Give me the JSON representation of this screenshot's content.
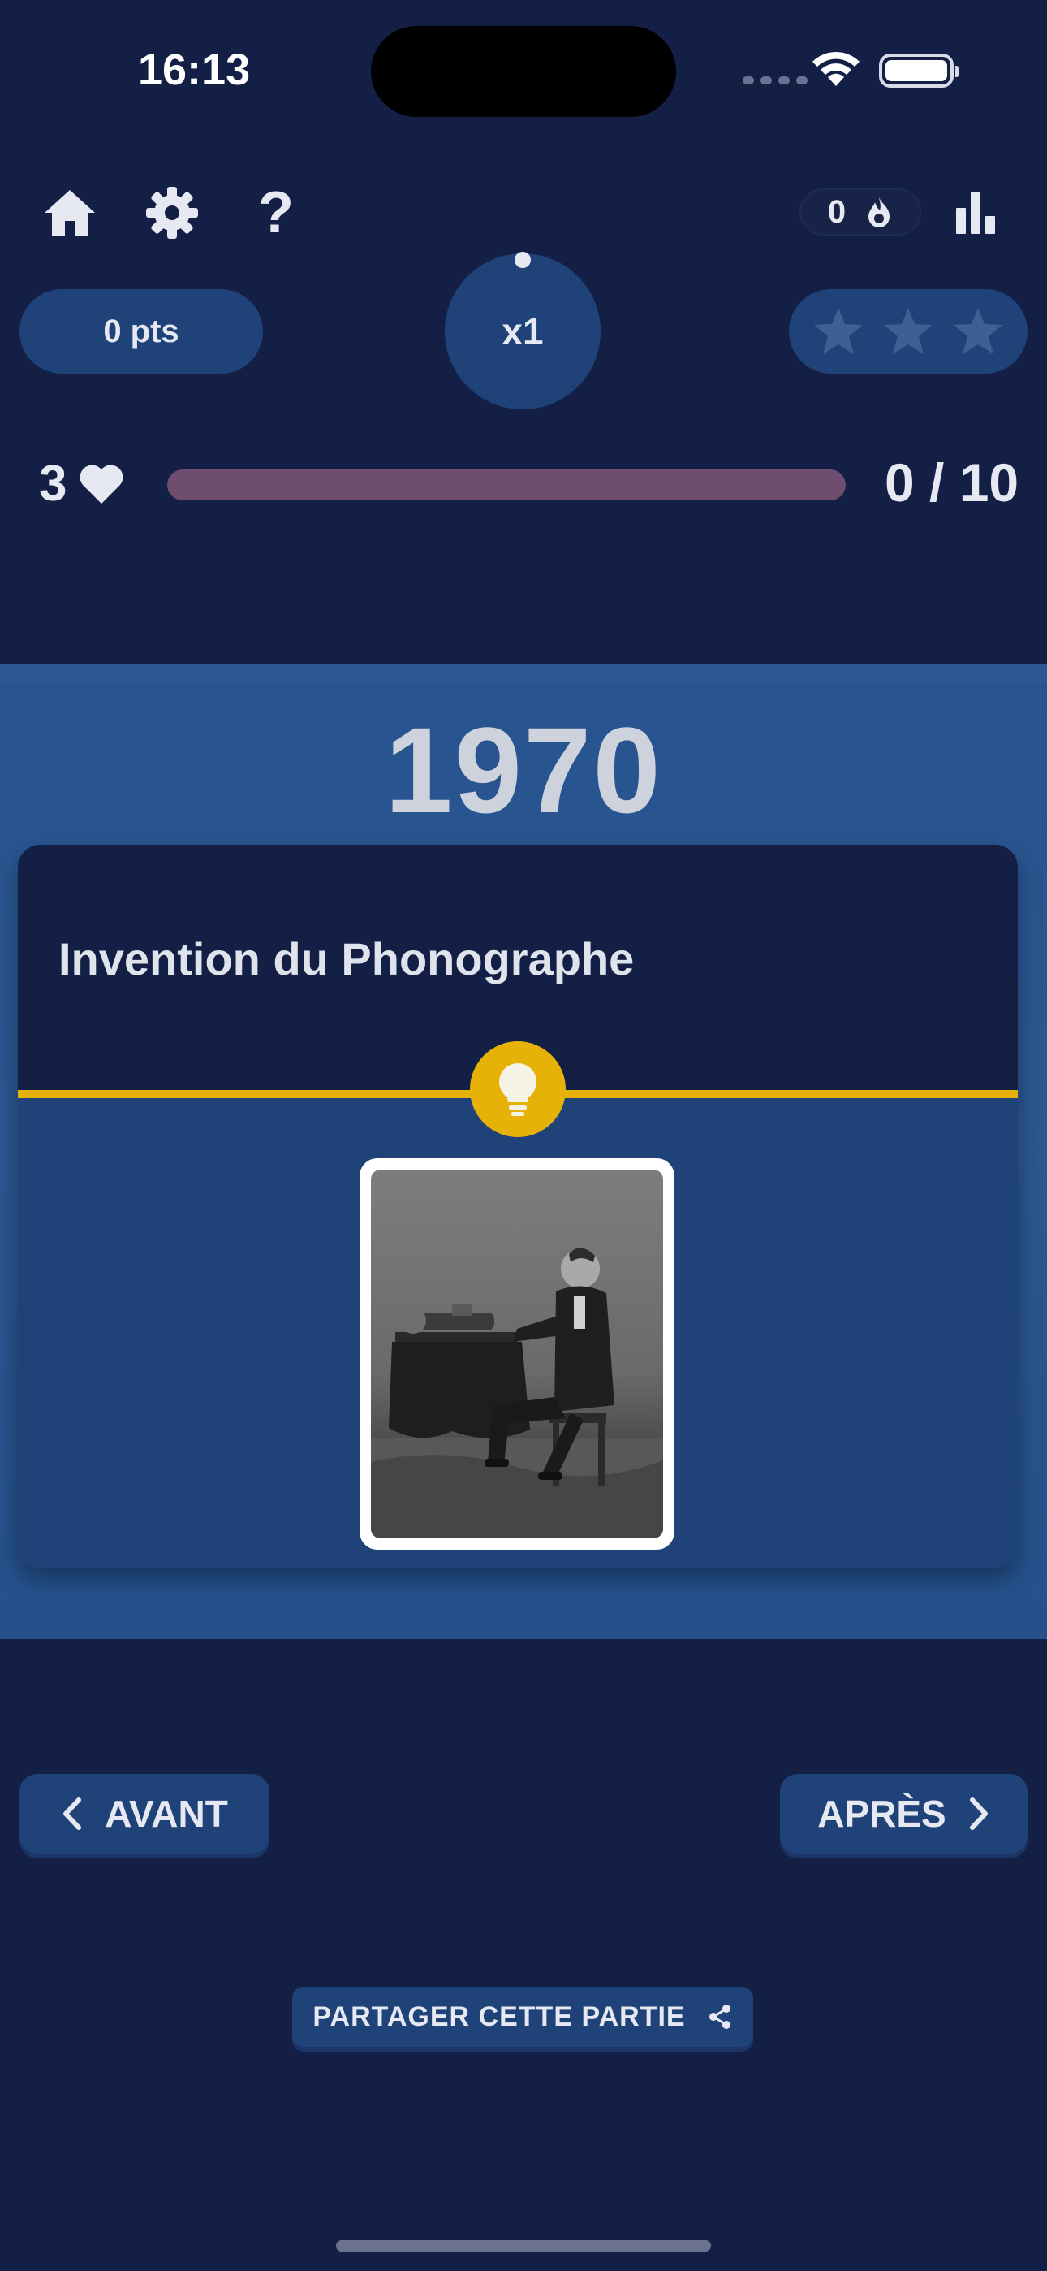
{
  "status_bar": {
    "time": "16:13"
  },
  "header": {
    "icons": [
      "home-icon",
      "gear-icon",
      "help-icon",
      "bar-chart-icon"
    ],
    "help_label": "?",
    "streak": {
      "count": "0",
      "icon": "flame-icon"
    }
  },
  "score": {
    "points": "0 pts",
    "multiplier": "x1",
    "stars_filled": 0,
    "stars_total": 3
  },
  "progress": {
    "lives": "3",
    "fraction": 0,
    "count": "0 / 10"
  },
  "event": {
    "year": "1970",
    "title": "Invention du Phonographe",
    "hint_icon": "lightbulb-icon"
  },
  "nav": {
    "before_label": "AVANT",
    "after_label": "APRÈS"
  },
  "share": {
    "label": "PARTAGER CETTE PARTIE"
  },
  "colors": {
    "background": "#141f45",
    "panel": "#1f4278",
    "accent": "#e7b208",
    "bar_track": "#6e4d6e",
    "text": "#e6e9f2"
  }
}
